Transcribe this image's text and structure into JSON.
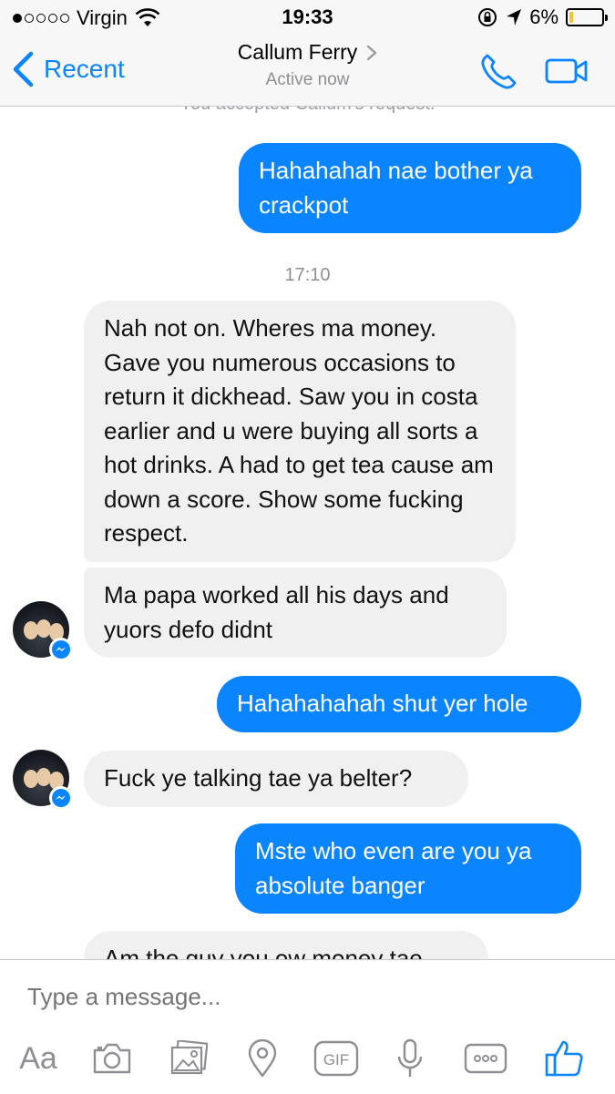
{
  "status_bar": {
    "carrier": "Virgin",
    "signal_bars_filled": 1,
    "signal_bars_total": 5,
    "time": "19:33",
    "battery_percent": "6%",
    "battery_level": 0.06,
    "battery_color": "#f2c531"
  },
  "nav": {
    "back_label": "Recent",
    "contact_name": "Callum Ferry",
    "status": "Active now",
    "accent_color": "#0a84ff"
  },
  "conversation": {
    "system_note": "You accepted Callum's request.",
    "timestamp": "17:10",
    "messages": [
      {
        "direction": "outgoing",
        "text": "Hahahahah nae bother ya crackpot"
      },
      {
        "direction": "incoming",
        "text": "Nah not on. Wheres ma money. Gave you numerous occasions to return it dickhead. Saw you in costa earlier and u were buying all sorts a hot drinks. A had to get tea cause am down a score. Show some fucking respect."
      },
      {
        "direction": "incoming",
        "text": "Ma papa worked all his days and yuors defo didnt"
      },
      {
        "direction": "outgoing",
        "text": "Hahahahahah shut yer hole"
      },
      {
        "direction": "incoming",
        "text": "Fuck ye talking tae ya belter?"
      },
      {
        "direction": "outgoing",
        "text": "Mste who even are you ya absolute banger"
      },
      {
        "direction": "incoming",
        "text": "Am the guy you ow money tae"
      }
    ]
  },
  "composer": {
    "placeholder": "Type a message...",
    "text_button": "Aa",
    "gif_label": "GIF",
    "icons": [
      "text-format-icon",
      "camera-icon",
      "photo-gallery-icon",
      "location-pin-icon",
      "gif-icon",
      "microphone-icon",
      "more-icon",
      "thumbs-up-icon"
    ]
  }
}
